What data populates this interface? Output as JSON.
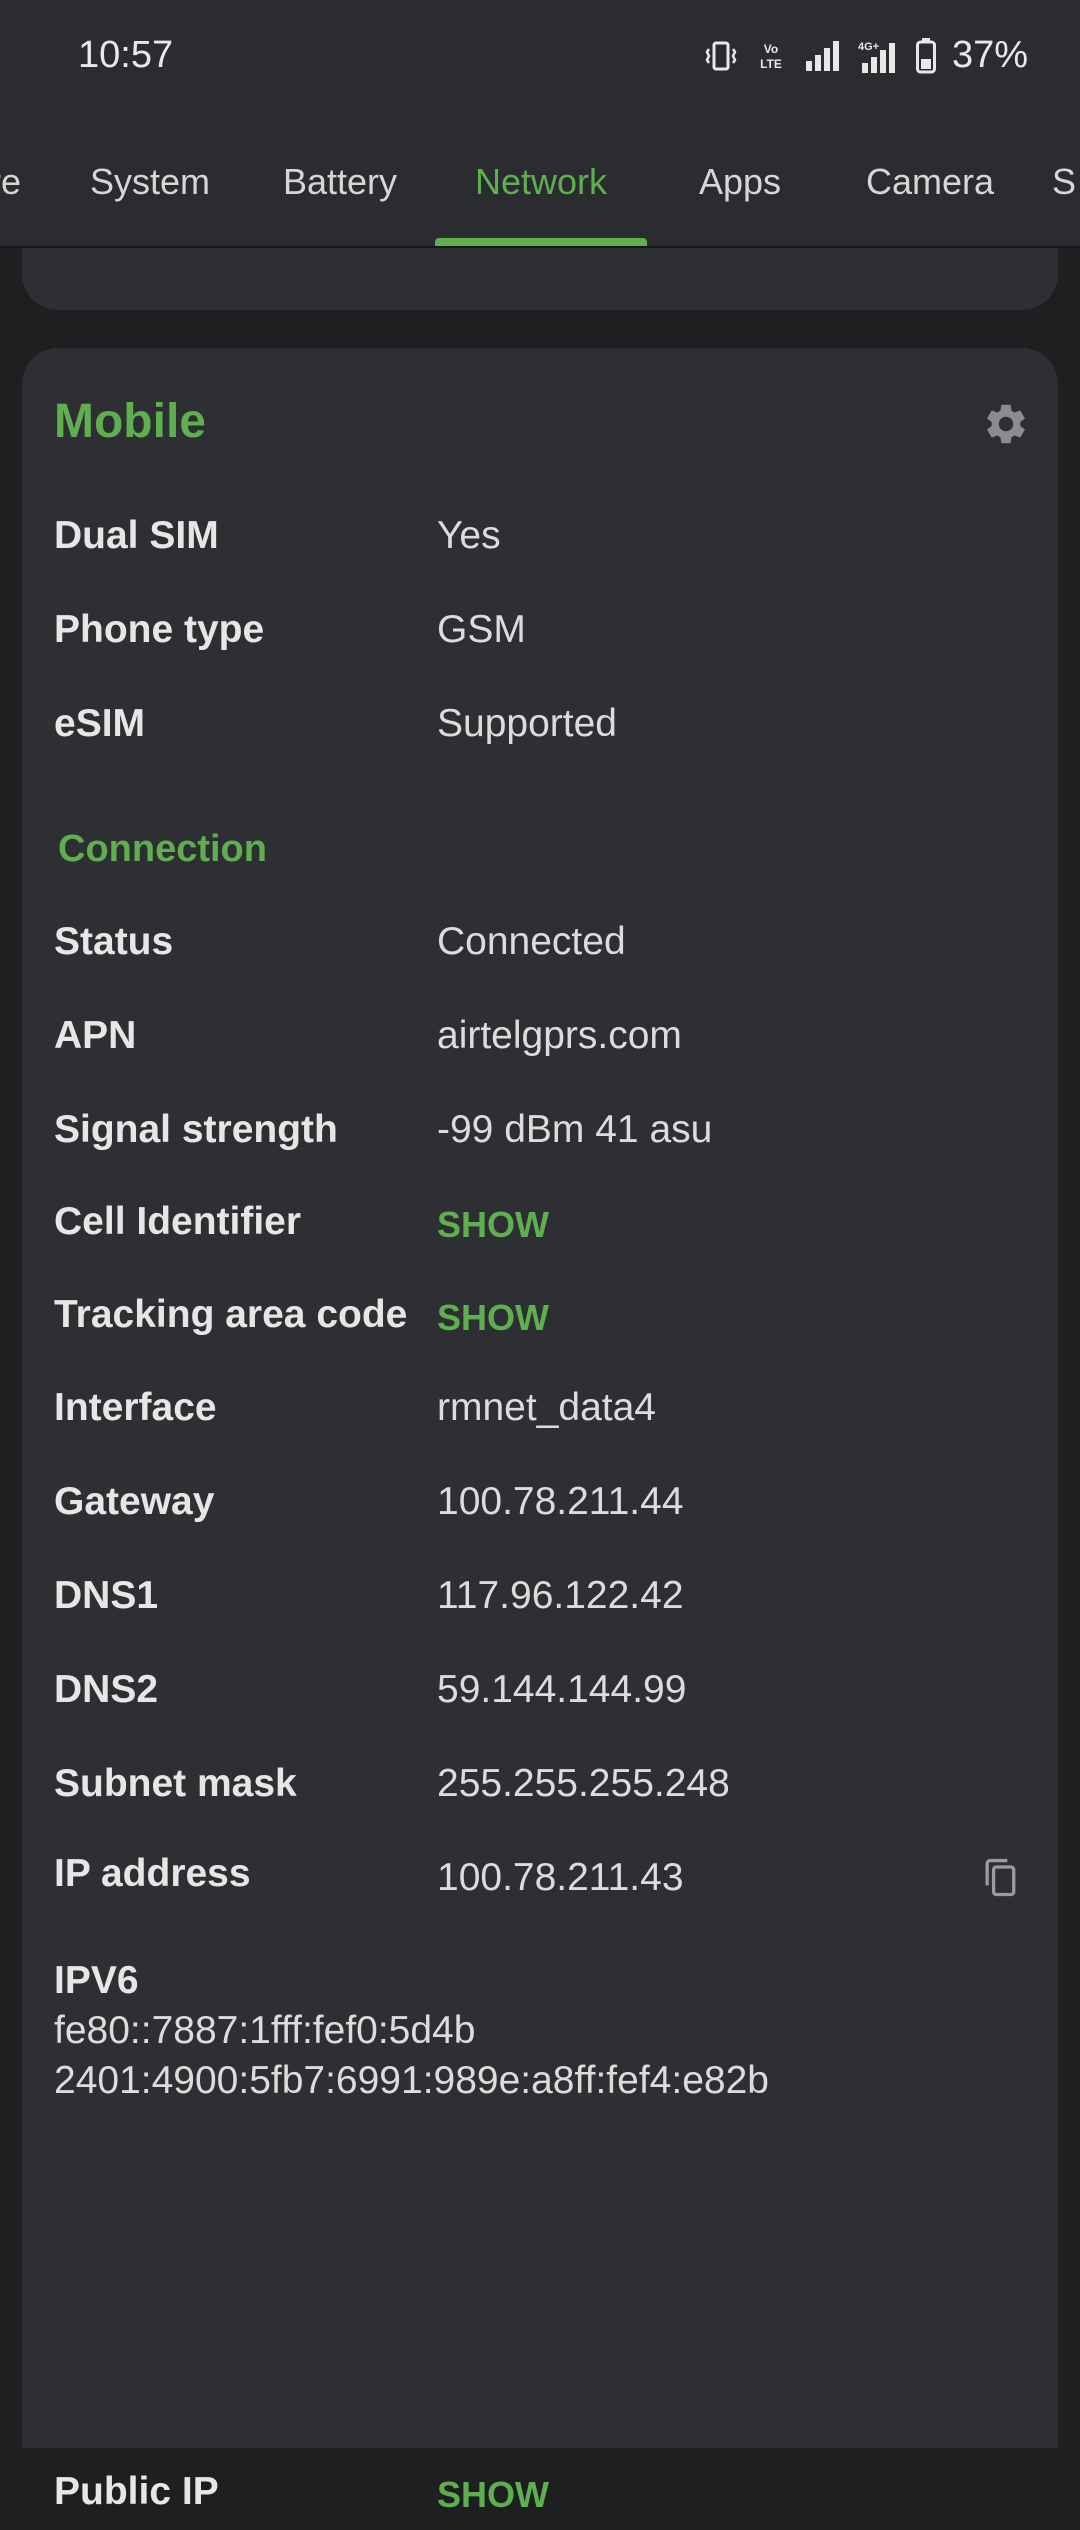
{
  "status_bar": {
    "time": "10:57",
    "battery": "37%",
    "network_badge": "4G+",
    "volte_top": "Vo",
    "volte_bottom": "LTE",
    "icons": [
      "vibrate-icon",
      "volte-icon",
      "signal-icon",
      "signal-4g-icon",
      "battery-icon"
    ]
  },
  "tabs": [
    {
      "label": "re"
    },
    {
      "label": "System"
    },
    {
      "label": "Battery"
    },
    {
      "label": "Network",
      "active": true
    },
    {
      "label": "Apps"
    },
    {
      "label": "Camera"
    },
    {
      "label": "S"
    }
  ],
  "card": {
    "title": "Mobile",
    "settings_icon": "gear-icon",
    "rows": [
      {
        "label": "Dual SIM",
        "value": "Yes"
      },
      {
        "label": "Phone type",
        "value": "GSM"
      },
      {
        "label": "eSIM",
        "value": "Supported"
      }
    ],
    "connection": {
      "header": "Connection",
      "status": {
        "label": "Status",
        "value": "Connected"
      },
      "apn": {
        "label": "APN",
        "value": "airtelgprs.com"
      },
      "signal": {
        "label": "Signal strength",
        "value": "-99 dBm 41 asu"
      },
      "cell_id": {
        "label": "Cell Identifier",
        "action": "SHOW"
      },
      "tac": {
        "label": "Tracking area code",
        "action": "SHOW"
      },
      "interface": {
        "label": "Interface",
        "value": "rmnet_data4"
      },
      "gateway": {
        "label": "Gateway",
        "value": "100.78.211.44"
      },
      "dns1": {
        "label": "DNS1",
        "value": "117.96.122.42"
      },
      "dns2": {
        "label": "DNS2",
        "value": "59.144.144.99"
      },
      "subnet": {
        "label": "Subnet mask",
        "value": "255.255.255.248"
      },
      "ip": {
        "label": "IP address",
        "value": "100.78.211.43"
      },
      "ipv6": {
        "label": "IPV6",
        "addresses": [
          "fe80::7887:1fff:fef0:5d4b",
          "2401:4900:5fb7:6991:989e:a8ff:fef4:e82b"
        ]
      },
      "public_ip": {
        "label": "Public IP",
        "action": "SHOW"
      }
    }
  },
  "colors": {
    "accent": "#5fae4f",
    "background": "#1e1f20",
    "card": "#2d2f32",
    "bar": "#2a2c2f"
  }
}
